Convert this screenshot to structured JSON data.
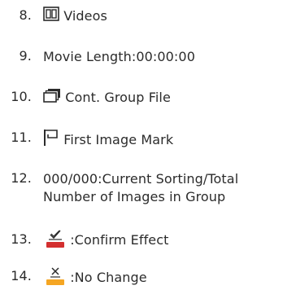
{
  "items": [
    {
      "number": "8.",
      "icon": "filmstrip-icon",
      "text": "Videos"
    },
    {
      "number": "9.",
      "icon": "",
      "text": "Movie Length:00:00:00"
    },
    {
      "number": "10.",
      "icon": "stacked-images-icon",
      "text": "Cont. Group File"
    },
    {
      "number": "11.",
      "icon": "flag-icon",
      "text": "First Image Mark"
    },
    {
      "number": "12.",
      "icon": "",
      "text": "000/000:Current Sorting/Total",
      "text2": "Number of Images in Group"
    },
    {
      "number": "13.",
      "icon": "checkmark-red-bar-icon",
      "text": ":Confirm Effect"
    },
    {
      "number": "14.",
      "icon": "x-orange-bar-icon",
      "text": ":No Change"
    }
  ],
  "colors": {
    "text": "#2b2b2b",
    "confirm_bar": "#d32f2f",
    "nochange_bar": "#f5a623"
  }
}
